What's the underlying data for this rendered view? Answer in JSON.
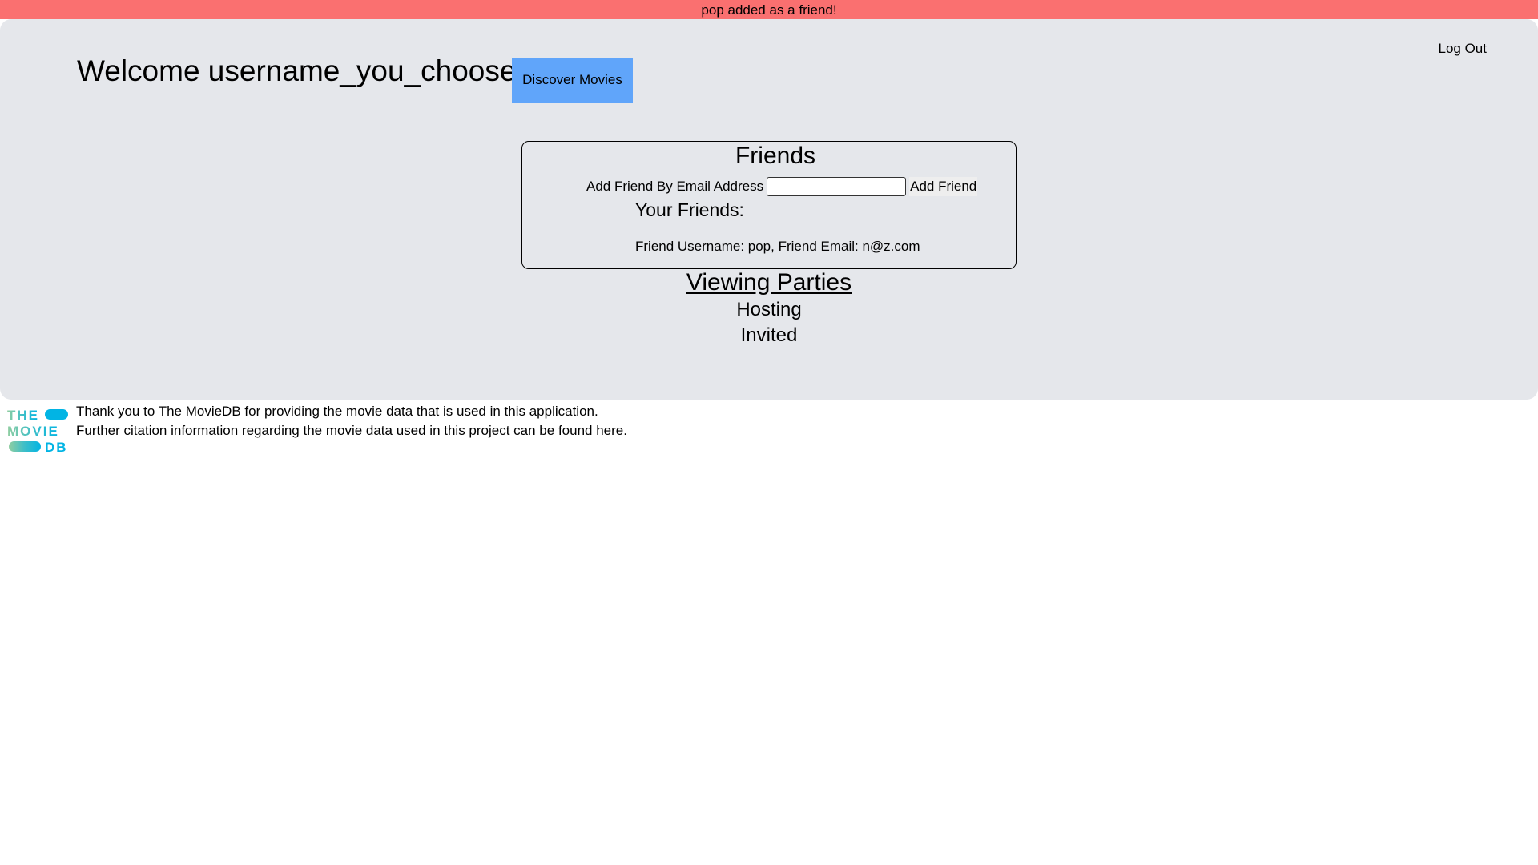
{
  "flash": {
    "message": "pop added as a friend!",
    "color": "#fa7070"
  },
  "header": {
    "logout_label": "Log Out",
    "welcome": "Welcome username_you_choose",
    "discover_label": "Discover Movies",
    "discover_color": "#60a5fa"
  },
  "friends": {
    "title": "Friends",
    "add_label": "Add Friend By Email Address",
    "email_value": "",
    "add_button": "Add Friend",
    "your_friends_heading": "Your Friends:",
    "list": [
      "Friend Username: pop, Friend Email: n@z.com"
    ]
  },
  "viewing_parties": {
    "title": "Viewing Parties",
    "hosting": "Hosting",
    "invited": "Invited"
  },
  "footer": {
    "logo": {
      "line1": "THE",
      "line2": "MOVIE",
      "line3": "DB",
      "icon": "tmdb-logo"
    },
    "line1": "Thank you to The MovieDB for providing the movie data that is used in this application.",
    "line2": "Further citation information regarding the movie data used in this project can be found here."
  },
  "panel_color": "#e5e7eb"
}
